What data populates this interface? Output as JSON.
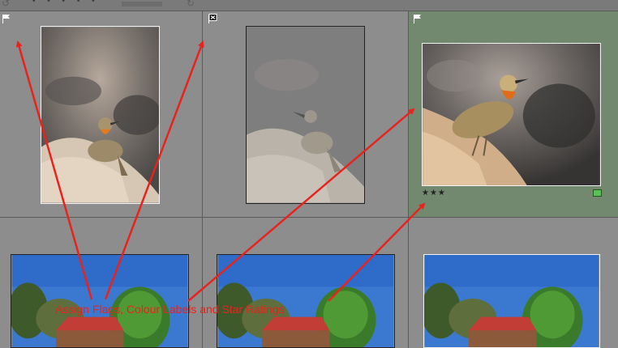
{
  "toolbar": {
    "rotate_left_icon": "rotate-left",
    "rotate_right_icon": "rotate-right",
    "dots": "• • • • •"
  },
  "grid": {
    "cells": [
      {
        "flag": "flagged",
        "selected": false,
        "photo": "bird-on-rock"
      },
      {
        "flag": "rejected",
        "selected": false,
        "photo": "bird-on-rock-dimmed"
      },
      {
        "flag": "flagged",
        "selected": true,
        "photo": "bird-on-rock",
        "stars": "★★★",
        "color_label": "green"
      },
      {
        "photo": "house-with-tree"
      },
      {
        "photo": "house-with-tree"
      },
      {
        "photo": "house-with-tree"
      }
    ]
  },
  "colors": {
    "selected_cell": "#72886f",
    "cell": "#8d8d8d",
    "annotation": "#e8231d",
    "color_label": "#5fbf57"
  },
  "annotation": {
    "text": "Assign Flags, Colour Labels and Star Ratings"
  }
}
